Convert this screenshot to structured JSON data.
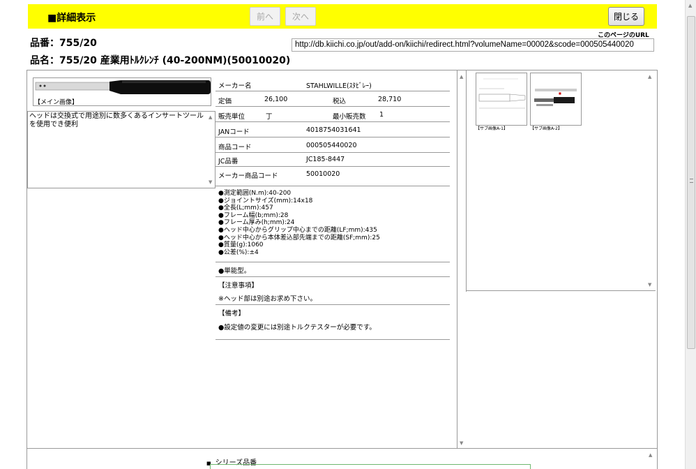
{
  "header": {
    "title": "■詳細表示",
    "prev_label": "前へ",
    "next_label": "次へ",
    "close_label": "閉じる"
  },
  "product": {
    "hinban": "品番：755/20",
    "hinmei": "品名：755/20 産業用ﾄﾙｸﾚﾝﾁ (40-200NM)(50010020)"
  },
  "url": {
    "label": "このページのURL",
    "value": "http://db.kiichi.co.jp/out/add-on/kiichi/redirect.html?volumeName=00002&scode=000505440020"
  },
  "main_image": {
    "caption": "【メイン画像】"
  },
  "description": "ヘッドは交換式で用途別に数多くあるインサートツールを使用でき便利",
  "specs": {
    "maker_label": "メーカー名",
    "maker_value": "STAHLWILLE(ｽﾀﾋﾞﾚｰ)",
    "price_label": "定価",
    "price_value": "26,100",
    "tax_label": "税込",
    "tax_value": "28,710",
    "unit_label": "販売単位",
    "unit_value": "丁",
    "min_label": "最小販売数",
    "min_value": "1",
    "jan_label": "JANコード",
    "jan_value": "4018754031641",
    "code_label": "商品コード",
    "code_value": "000505440020",
    "jc_label": "JC品番",
    "jc_value": "JC185-8447",
    "maker_code_label": "メーカー商品コード",
    "maker_code_value": "50010020"
  },
  "features": "●測定範囲(N.m):40-200\n●ジョイントサイズ(mm):14x18\n●全長(L;mm):457\n●フレーム幅(b;mm):28\n●フレーム厚み(h;mm):24\n●ヘッド中心からグリップ中心までの距離(LF;mm):435\n●ヘッド中心から本体差込部先端までの距離(SF;mm):25\n●質量(g):1060\n●公差(%):±4",
  "type_note": "●単能型。",
  "caution": {
    "heading": "【注意事項】",
    "text": "※ヘッド部は別途お求め下さい。"
  },
  "remarks": {
    "heading": "【備考】",
    "text": "●設定値の変更には別途トルクテスターが必要です。"
  },
  "sub_images": [
    {
      "caption": "【サブ画像A-1】"
    },
    {
      "caption": "【サブ画像A-2】"
    }
  ],
  "series": {
    "label": "シリーズ品番"
  }
}
